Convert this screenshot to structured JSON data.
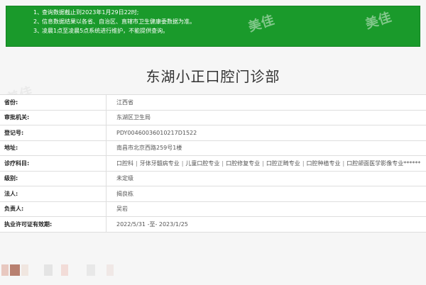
{
  "notice": {
    "items": [
      {
        "num": "1、",
        "text": "查询数据截止到2023年1月29日22时;"
      },
      {
        "num": "2、",
        "text": "信息数据结果以各省、自治区、直辖市卫生健康委数据为准。"
      },
      {
        "num": "3、",
        "text": "凌晨1点至凌晨5点系统进行维护，不能提供查询。"
      }
    ],
    "watermark": "美佳"
  },
  "page_title": "东湖小正口腔门诊部",
  "rows": [
    {
      "label": "省份:",
      "value": "江西省"
    },
    {
      "label": "审批机关:",
      "value": "东湖区卫生局"
    },
    {
      "label": "登记号:",
      "value": "PDY00460036010217D1522"
    },
    {
      "label": "地址:",
      "value": "南昌市北京西路259号1楼"
    },
    {
      "label": "诊疗科目:",
      "value_items": [
        "口腔科",
        "牙体牙髓病专业",
        "儿童口腔专业",
        "口腔修复专业",
        "口腔正畸专业",
        "口腔种植专业",
        "口腔颌面医学影像专业******"
      ]
    },
    {
      "label": "级别:",
      "value": "未定级"
    },
    {
      "label": "法人:",
      "value": "揭良栋"
    },
    {
      "label": "负责人:",
      "value": "吴岩"
    },
    {
      "label": "执业许可证有效期:",
      "value": "2022/5/31 -至- 2023/1/25"
    }
  ],
  "colors": {
    "notice_bg": "#1a9a2b",
    "label_text": "#222222",
    "value_text": "#555555"
  }
}
